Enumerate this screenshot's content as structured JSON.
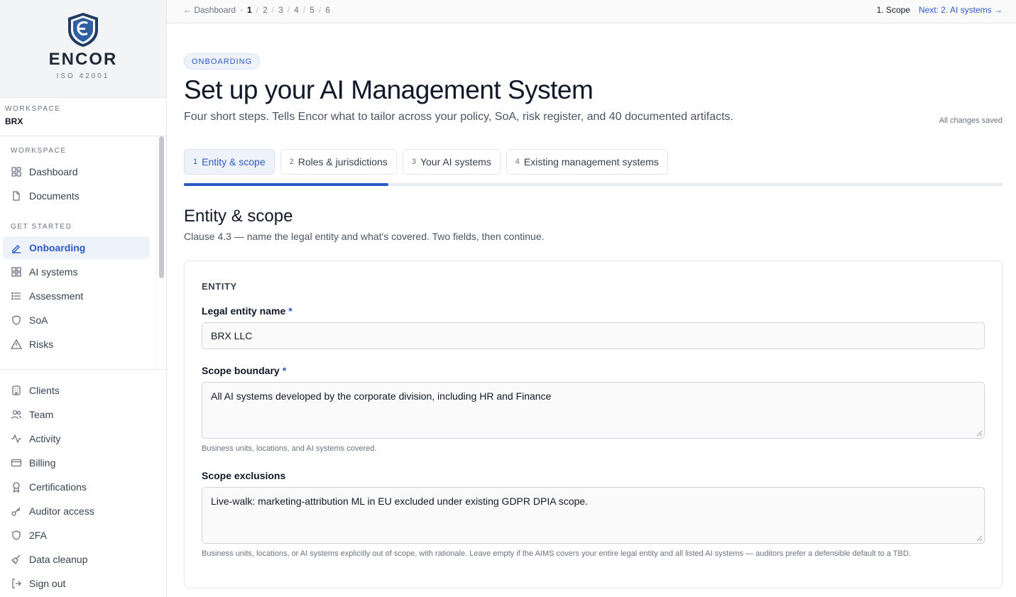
{
  "brand": {
    "name": "ENCOR",
    "sub": "ISO 42001"
  },
  "workspace": {
    "label": "WORKSPACE",
    "name": "BRX"
  },
  "sidebar": {
    "section_workspace": "WORKSPACE",
    "section_get_started": "GET STARTED",
    "items_workspace": [
      {
        "label": "Dashboard",
        "icon": "dashboard-icon"
      },
      {
        "label": "Documents",
        "icon": "document-icon"
      }
    ],
    "items_get_started": [
      {
        "label": "Onboarding",
        "icon": "pen-icon",
        "active": true
      },
      {
        "label": "AI systems",
        "icon": "grid-icon"
      },
      {
        "label": "Assessment",
        "icon": "list-icon"
      },
      {
        "label": "SoA",
        "icon": "shield-icon"
      },
      {
        "label": "Risks",
        "icon": "warning-icon"
      }
    ],
    "items_bottom": [
      {
        "label": "Clients",
        "icon": "building-icon"
      },
      {
        "label": "Team",
        "icon": "users-icon"
      },
      {
        "label": "Activity",
        "icon": "activity-icon"
      },
      {
        "label": "Billing",
        "icon": "card-icon"
      },
      {
        "label": "Certifications",
        "icon": "award-icon"
      },
      {
        "label": "Auditor access",
        "icon": "key-icon"
      },
      {
        "label": "2FA",
        "icon": "shield-icon"
      },
      {
        "label": "Data cleanup",
        "icon": "broom-icon"
      },
      {
        "label": "Sign out",
        "icon": "sign-out-icon"
      }
    ]
  },
  "topbar": {
    "back_label": "← Dashboard",
    "dot": "·",
    "steps": [
      "1",
      "2",
      "3",
      "4",
      "5",
      "6"
    ],
    "current_step": "1. Scope",
    "next_label": "Next: 2. AI systems →"
  },
  "header": {
    "badge": "ONBOARDING",
    "title": "Set up your AI Management System",
    "subtitle": "Four short steps. Tells Encor what to tailor across your policy, SoA, risk register, and 40 documented artifacts.",
    "saved": "All changes saved"
  },
  "tabs": [
    {
      "num": "1",
      "label": "Entity & scope",
      "active": true
    },
    {
      "num": "2",
      "label": "Roles & jurisdictions"
    },
    {
      "num": "3",
      "label": "Your AI systems"
    },
    {
      "num": "4",
      "label": "Existing management systems"
    }
  ],
  "progress": {
    "fraction": 0.25
  },
  "section": {
    "title": "Entity & scope",
    "desc": "Clause 4.3 — name the legal entity and what's covered. Two fields, then continue."
  },
  "card": {
    "heading": "ENTITY",
    "legal_label": "Legal entity name",
    "legal_value": "BRX LLC",
    "required_mark": "*",
    "boundary_label": "Scope boundary",
    "boundary_value": "All AI systems developed by the corporate division, including HR and Finance",
    "boundary_help": "Business units, locations, and AI systems covered.",
    "exclusions_label": "Scope exclusions",
    "exclusions_value": "Live-walk: marketing-attribution ML in EU excluded under existing GDPR DPIA scope.",
    "exclusions_help": "Business units, locations, or AI systems explicitly out of scope, with rationale. Leave empty if the AIMS covers your entire legal entity and all listed AI systems — auditors prefer a defensible default to a TBD."
  },
  "colors": {
    "accent": "#2b59c3",
    "accent_bg": "#eef2fb"
  }
}
